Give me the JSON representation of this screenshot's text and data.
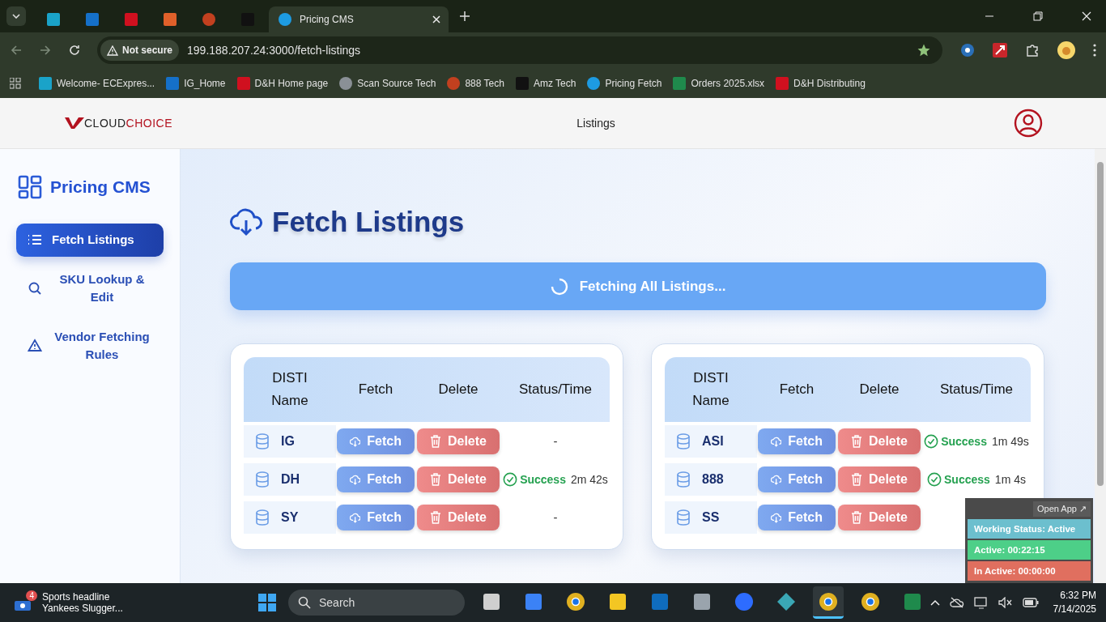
{
  "browser": {
    "tabs": [
      {
        "kind": "ec",
        "selected": false
      },
      {
        "kind": "ig",
        "selected": false
      },
      {
        "kind": "dh",
        "selected": false
      },
      {
        "kind": "box",
        "selected": false
      },
      {
        "kind": "ring",
        "selected": false
      },
      {
        "kind": "amazon",
        "selected": false
      },
      {
        "kind": "dollar",
        "title": "Pricing CMS",
        "selected": true
      }
    ],
    "address": {
      "security": "Not secure",
      "url": "199.188.207.24:3000/fetch-listings"
    },
    "bookmarks": [
      {
        "kind": "ec",
        "label": "Welcome- ECExpres..."
      },
      {
        "kind": "ig",
        "label": "IG_Home"
      },
      {
        "kind": "dh",
        "label": "D&H Home page"
      },
      {
        "kind": "globe",
        "label": "Scan Source Tech"
      },
      {
        "kind": "ring",
        "label": "888 Tech"
      },
      {
        "kind": "amazon",
        "label": "Amz Tech"
      },
      {
        "kind": "dollar",
        "label": "Pricing Fetch"
      },
      {
        "kind": "excel",
        "label": "Orders 2025.xlsx"
      },
      {
        "kind": "dh",
        "label": "D&H Distributing"
      }
    ]
  },
  "header": {
    "logo": {
      "first": "CLOUD",
      "second": "CHOICE"
    },
    "nav": "Listings"
  },
  "sidebar": {
    "title": "Pricing CMS",
    "items": [
      {
        "kind": "list",
        "label": "Fetch Listings",
        "selected": true
      },
      {
        "kind": "search",
        "label": "SKU Lookup & Edit",
        "selected": false
      },
      {
        "kind": "warning",
        "label": "Vendor Fetching Rules",
        "selected": false
      }
    ]
  },
  "main": {
    "title": "Fetch Listings",
    "banner": "Fetching All Listings...",
    "tables": [
      {
        "columns": [
          "DISTI Name",
          "Fetch",
          "Delete",
          "Status/Time"
        ],
        "rows": [
          {
            "name": "IG",
            "fetch": "Fetch",
            "delete": "Delete",
            "status": {
              "kind": "none",
              "text": "-"
            }
          },
          {
            "name": "DH",
            "fetch": "Fetch",
            "delete": "Delete",
            "status": {
              "kind": "success",
              "label": "Success",
              "time": "2m 42s"
            }
          },
          {
            "name": "SY",
            "fetch": "Fetch",
            "delete": "Delete",
            "status": {
              "kind": "none",
              "text": "-"
            }
          }
        ]
      },
      {
        "columns": [
          "DISTI Name",
          "Fetch",
          "Delete",
          "Status/Time"
        ],
        "rows": [
          {
            "name": "ASI",
            "fetch": "Fetch",
            "delete": "Delete",
            "status": {
              "kind": "success",
              "label": "Success",
              "time": "1m 49s"
            }
          },
          {
            "name": "888",
            "fetch": "Fetch",
            "delete": "Delete",
            "status": {
              "kind": "success",
              "label": "Success",
              "time": "1m 4s"
            }
          },
          {
            "name": "SS",
            "fetch": "Fetch",
            "delete": "Delete"
          }
        ]
      }
    ]
  },
  "widget": {
    "open": "Open App ↗",
    "lines": [
      {
        "kind": "status",
        "text": "Working Status: Active"
      },
      {
        "kind": "active",
        "text": "Active: 00:22:15"
      },
      {
        "kind": "inactive",
        "text": "In Active: 00:00:00"
      }
    ]
  },
  "taskbar": {
    "news": {
      "badge": "4",
      "title": "Sports headline",
      "text": "Yankees Slugger..."
    },
    "search": "Search",
    "apps": [
      {
        "kind": "files",
        "selected": false
      },
      {
        "kind": "store",
        "selected": false
      },
      {
        "kind": "chrome",
        "selected": false
      },
      {
        "kind": "folder",
        "selected": false
      },
      {
        "kind": "outlook",
        "selected": false
      },
      {
        "kind": "calculator",
        "selected": false
      },
      {
        "kind": "zoom",
        "selected": false
      },
      {
        "kind": "diamond",
        "selected": false
      },
      {
        "kind": "chrome",
        "selected": true
      },
      {
        "kind": "chrome",
        "selected": false
      },
      {
        "kind": "excel",
        "selected": false
      }
    ],
    "time": "6:32 PM",
    "date": "7/14/2025"
  }
}
